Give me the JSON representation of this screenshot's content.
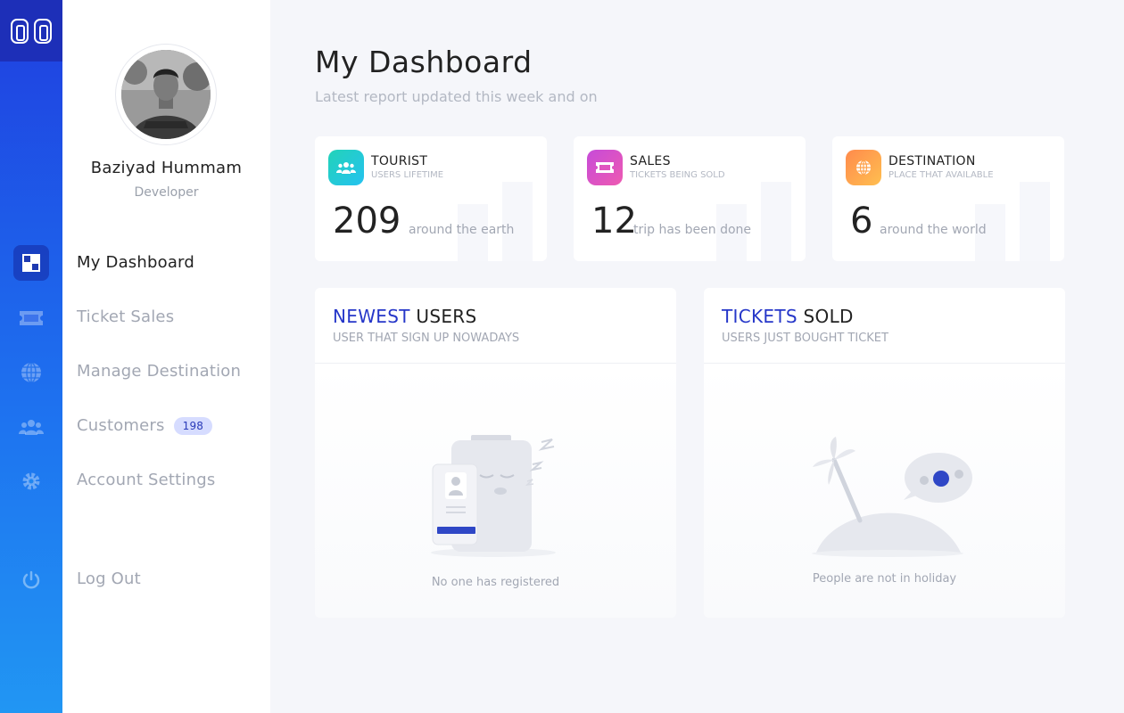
{
  "app": {
    "logo": "logo-icon",
    "accent": "#2637c9",
    "rail_gradient": [
      "#1f3fe0",
      "#2196f3"
    ]
  },
  "profile": {
    "name": "Baziyad Hummam",
    "role": "Developer"
  },
  "nav": {
    "items": [
      {
        "label": "My Dashboard",
        "icon": "dashboard-icon",
        "active": true
      },
      {
        "label": "Ticket Sales",
        "icon": "ticket-icon",
        "active": false
      },
      {
        "label": "Manage Destination",
        "icon": "globe-icon",
        "active": false
      },
      {
        "label": "Customers",
        "icon": "users-icon",
        "active": false,
        "badge": "198"
      },
      {
        "label": "Account Settings",
        "icon": "gear-icon",
        "active": false
      }
    ],
    "logout": {
      "label": "Log Out",
      "icon": "power-icon"
    }
  },
  "main": {
    "title": "My Dashboard",
    "subtitle": "Latest report updated this week and on",
    "stats": [
      {
        "title": "TOURIST",
        "subtitle": "USERS LIFETIME",
        "value": "209",
        "desc": "around the earth",
        "icon": "users-icon",
        "color": [
          "#22d3b8",
          "#25c2f0"
        ]
      },
      {
        "title": "SALES",
        "subtitle": "TICKETS BEING SOLD",
        "value": "12",
        "desc": "trip has been done",
        "icon": "ticket-icon",
        "color": [
          "#c64bd9",
          "#ee5ab1"
        ]
      },
      {
        "title": "DESTINATION",
        "subtitle": "PLACE THAT AVAILABLE",
        "value": "6",
        "desc": "around the world",
        "icon": "globe-icon",
        "color": [
          "#ff8a4c",
          "#ffbf50"
        ]
      }
    ],
    "newest_users": {
      "title_highlight": "NEWEST",
      "title_rest": "USERS",
      "subtitle": "USER THAT SIGN UP NOWADAYS",
      "empty": "No one has registered"
    },
    "tickets_sold": {
      "title_highlight": "TICKETS",
      "title_rest": "SOLD",
      "subtitle": "USERS JUST BOUGHT TICKET",
      "empty": "People are not in holiday"
    }
  }
}
